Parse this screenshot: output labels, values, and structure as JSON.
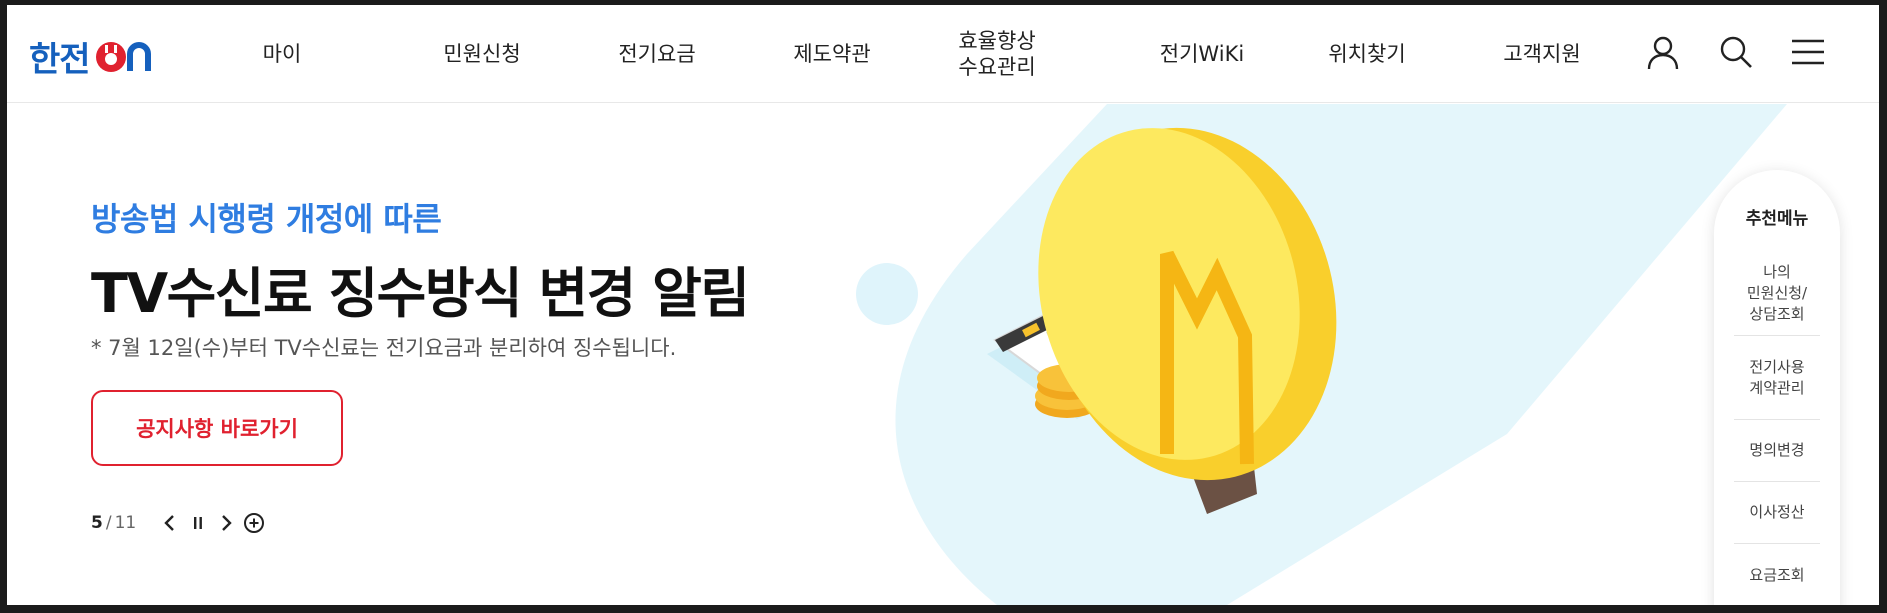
{
  "header": {
    "logo_text": "한전",
    "logo_suffix": "ON",
    "nav": [
      {
        "label": "마이"
      },
      {
        "label": "민원신청"
      },
      {
        "label": "전기요금"
      },
      {
        "label": "제도약관"
      },
      {
        "label": "효율향상\n수요관리"
      },
      {
        "label": "전기WiKi"
      },
      {
        "label": "위치찾기"
      },
      {
        "label": "고객지원"
      }
    ],
    "icons": [
      "user-icon",
      "search-icon",
      "menu-icon"
    ]
  },
  "hero": {
    "subtitle": "방송법 시행령 개정에 따른",
    "title": "TV수신료 징수방식 변경 알림",
    "description": "* 7월 12일(수)부터 TV수신료는 전기요금과 분리하여 징수됩니다.",
    "cta_label": "공지사항 바로가기",
    "pager": {
      "current": "5",
      "separator": "/",
      "total": "11"
    }
  },
  "side_menu": {
    "title": "추천메뉴",
    "items": [
      {
        "label": "나의\n민원신청/\n상담조회"
      },
      {
        "label": "전기사용\n계약관리"
      },
      {
        "label": "명의변경"
      },
      {
        "label": "이사정산"
      },
      {
        "label": "요금조회"
      }
    ]
  },
  "colors": {
    "brand_blue": "#1560bd",
    "logo_red": "#e0212f",
    "subtitle_blue": "#2f7de1",
    "cta_red": "#e0212f",
    "illustration_bg": "#e4f6fb",
    "bulb_yellow": "#fde04a"
  }
}
